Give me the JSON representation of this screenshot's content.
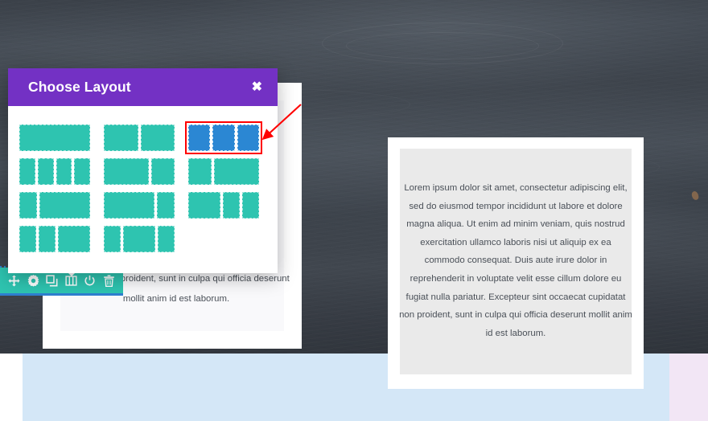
{
  "page": {
    "background_top_color": "#3f454e",
    "background_band_color": "#d4e7f7",
    "background_band_accent_color": "#f2e6f5"
  },
  "modal": {
    "title": "Choose Layout",
    "close_label": "✖",
    "close_icon": "close-icon",
    "header_color": "#7331c4",
    "option_color": "#2ec4b0",
    "selected_color": "#2b87d3",
    "highlight_color": "#ff0000",
    "rows": [
      {
        "options": [
          {
            "id": "layout-1-col",
            "label": "1 column",
            "segments": [
              100
            ],
            "selected": false
          },
          {
            "id": "layout-2-col",
            "label": "2 columns",
            "segments": [
              50,
              50
            ],
            "selected": false
          },
          {
            "id": "layout-3-col",
            "label": "3 columns",
            "segments": [
              33.33,
              33.33,
              33.33
            ],
            "selected": true
          }
        ]
      },
      {
        "options": [
          {
            "id": "layout-4-col",
            "label": "4 columns",
            "segments": [
              25,
              25,
              25,
              25
            ],
            "selected": false
          },
          {
            "id": "layout-2-3-1-3",
            "label": "2/3 + 1/3",
            "segments": [
              66.66,
              33.33
            ],
            "selected": false
          },
          {
            "id": "layout-1-3-2-3",
            "label": "1/3 + 2/3",
            "segments": [
              33.33,
              66.66
            ],
            "selected": false
          }
        ]
      },
      {
        "options": [
          {
            "id": "layout-1-4-3-4",
            "label": "1/4 + 3/4",
            "segments": [
              25,
              75
            ],
            "selected": false
          },
          {
            "id": "layout-3-4-1-4",
            "label": "3/4 + 1/4",
            "segments": [
              75,
              25
            ],
            "selected": false
          },
          {
            "id": "layout-1-2-1-4-1-4",
            "label": "1/2 + 1/4 + 1/4",
            "segments": [
              50,
              25,
              25
            ],
            "selected": false
          }
        ]
      },
      {
        "options": [
          {
            "id": "layout-1-4-1-4-1-2",
            "label": "1/4 + 1/4 + 1/2",
            "segments": [
              25,
              25,
              50
            ],
            "selected": false
          },
          {
            "id": "layout-1-4-1-2-1-4",
            "label": "1/4 + 1/2 + 1/4",
            "segments": [
              25,
              50,
              25
            ],
            "selected": false
          },
          {
            "id": "layout-empty-slot",
            "label": "",
            "segments": [],
            "selected": false
          }
        ]
      }
    ]
  },
  "module_toolbar": {
    "background_color": "#2ec4b0",
    "underline_color": "#2f7fd0",
    "items": [
      {
        "id": "move",
        "icon": "move-arrows-icon",
        "label": "Move"
      },
      {
        "id": "settings",
        "icon": "gear-icon",
        "label": "Settings"
      },
      {
        "id": "duplicate",
        "icon": "duplicate-icon",
        "label": "Duplicate"
      },
      {
        "id": "columns",
        "icon": "columns-icon",
        "label": "Change Column Structure"
      },
      {
        "id": "disable",
        "icon": "power-icon",
        "label": "Disable"
      },
      {
        "id": "delete",
        "icon": "trash-icon",
        "label": "Delete"
      }
    ]
  },
  "content": {
    "left_block_text": "cupidatat non proident, sunt in culpa qui officia deserunt mollit anim id est laborum.",
    "right_block_text": "Lorem ipsum dolor sit amet, consectetur adipiscing elit, sed do eiusmod tempor incididunt ut labore et dolore magna aliqua. Ut enim ad minim veniam, quis nostrud exercitation ullamco laboris nisi ut aliquip ex ea commodo consequat. Duis aute irure dolor in reprehenderit in voluptate velit esse cillum dolore eu fugiat nulla pariatur. Excepteur sint occaecat cupidatat non proident, sunt in culpa qui officia deserunt mollit anim id est laborum."
  },
  "annotation": {
    "arrow_color": "#ff0000",
    "points_to": "layout-3-col"
  }
}
